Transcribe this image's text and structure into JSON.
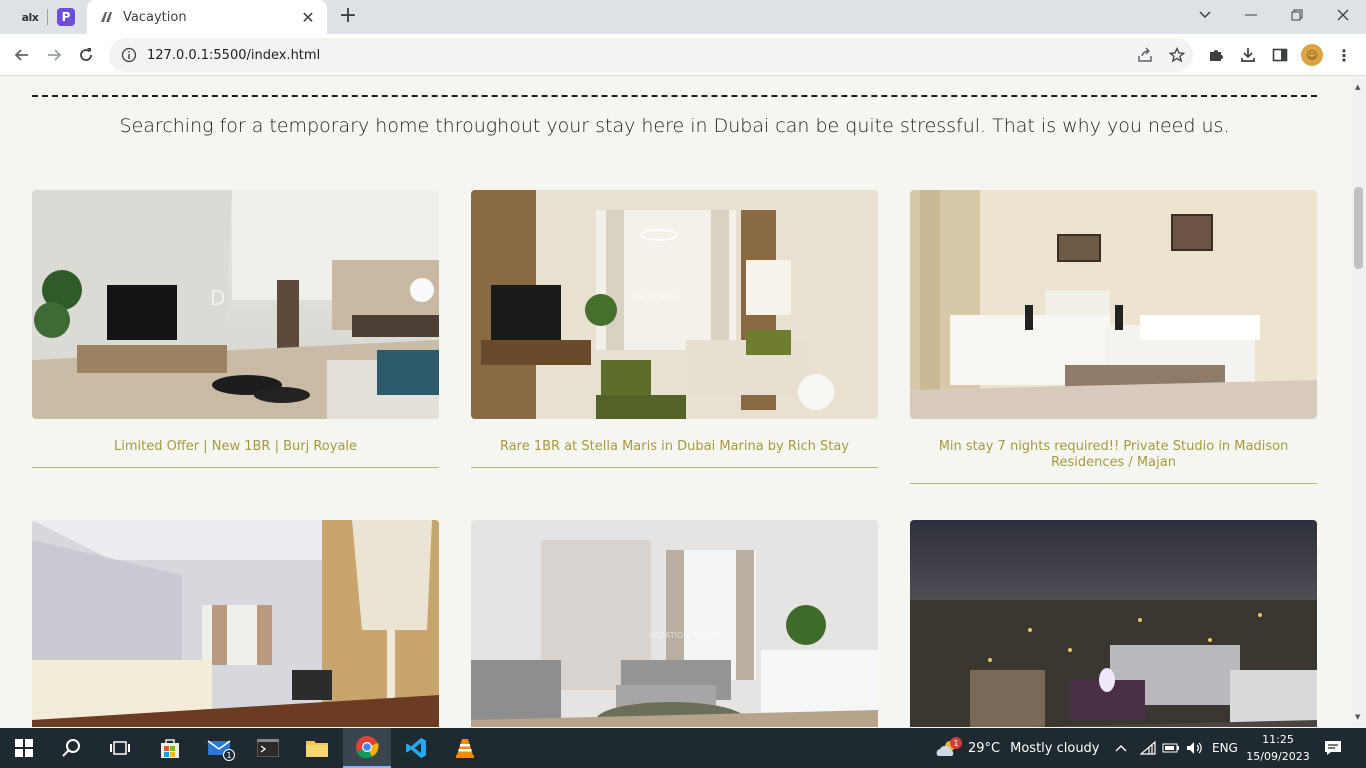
{
  "browser": {
    "pinned_tabs": [
      {
        "label": "alx"
      },
      {
        "label": "P"
      }
    ],
    "active_tab": {
      "title": "Vacaytion"
    },
    "url": "127.0.0.1:5500/index.html"
  },
  "page": {
    "intro": "Searching for a temporary home throughout your stay here in Dubai can be quite stressful. That is why you need us.",
    "listings": [
      {
        "title": "Limited Offer | New 1BR | Burj Royale",
        "watermark": "DRIVEN"
      },
      {
        "title": "Rare 1BR at Stella Maris in Dubai Marina by Rich Stay",
        "watermark": "RICH STAY"
      },
      {
        "title": "Min stay 7 nights required!! Private Studio in Madison Residences / Majan",
        "watermark": ""
      },
      {
        "title": "",
        "watermark": ""
      },
      {
        "title": "",
        "watermark": "VACATION RENTAL"
      },
      {
        "title": "",
        "watermark": ""
      }
    ]
  },
  "taskbar": {
    "weather": {
      "temp": "29°C",
      "condition": "Mostly cloudy",
      "badge": "1"
    },
    "mail_badge": "1",
    "language": "ENG",
    "time": "11:25",
    "date": "15/09/2023"
  },
  "colors": {
    "accent_gold": "#a69a3e",
    "page_bg": "#f5f6f1",
    "taskbar_bg": "#1f2a30"
  }
}
